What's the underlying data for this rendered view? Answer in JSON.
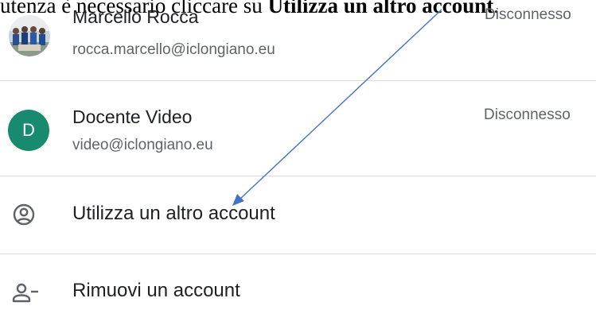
{
  "instruction": {
    "prefix": "utenza è necessario cliccare su ",
    "bold": "Utilizza un altro account",
    "suffix": "."
  },
  "accounts": [
    {
      "name": "Marcello Rocca",
      "email": "rocca.marcello@iclongiano.eu",
      "status": "Disconnesso",
      "avatar": "photo"
    },
    {
      "name": "Docente Video",
      "email": "video@iclongiano.eu",
      "status": "Disconnesso",
      "avatar_letter": "D",
      "avatar_color": "#188a6d"
    }
  ],
  "actions": {
    "add_account": {
      "label": "Utilizza un altro account",
      "icon": "account-circle-icon"
    },
    "remove_account": {
      "label": "Rimuovi un account",
      "icon": "person-remove-icon"
    }
  },
  "annotation": {
    "arrow_color": "#4472c4"
  }
}
